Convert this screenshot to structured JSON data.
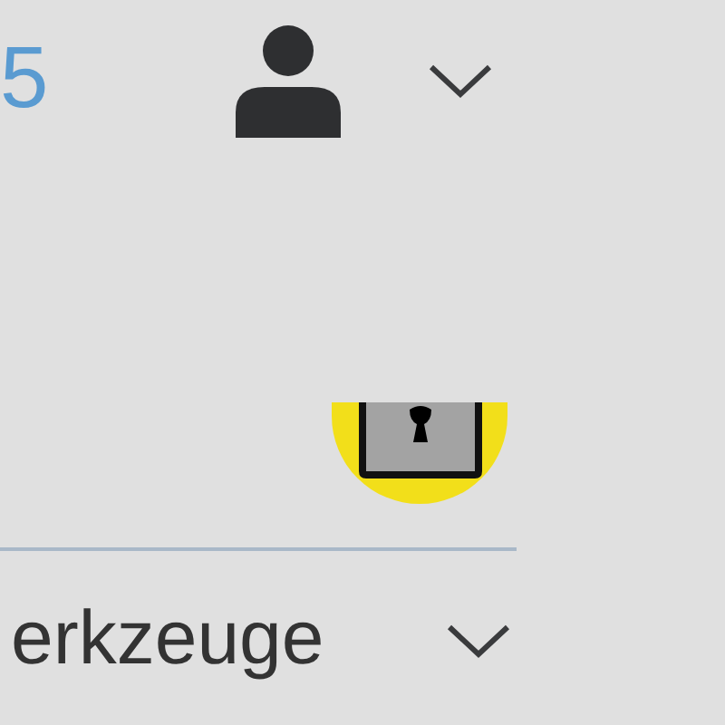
{
  "header": {
    "count": "5"
  },
  "tools_menu": {
    "label": "erkzeuge"
  }
}
